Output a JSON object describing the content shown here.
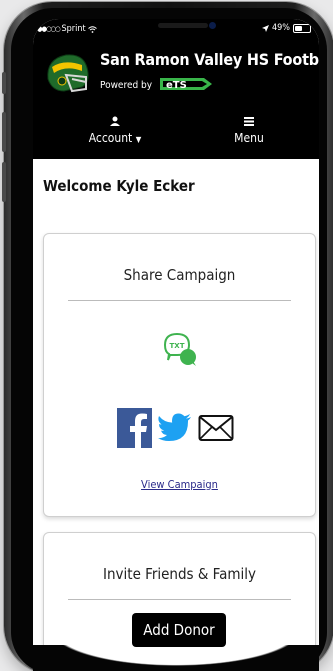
{
  "status": {
    "carrier": "Sprint",
    "signal_dots": "●●○○○",
    "battery_pct": "49%",
    "battery_level": 0.49
  },
  "header": {
    "team_name": "San Ramon Valley HS Football",
    "powered_by": "Powered by",
    "ets_text": "eTS"
  },
  "nav": {
    "account_label": "Account",
    "menu_label": "Menu"
  },
  "main": {
    "welcome": "Welcome Kyle Ecker",
    "share_card": {
      "title": "Share Campaign",
      "txt_label": "TXT",
      "view_link": "View Campaign"
    },
    "invite_card": {
      "title": "Invite Friends & Family",
      "button_label": "Add Donor"
    }
  },
  "colors": {
    "facebook": "#3b5998",
    "twitter": "#1da1f2",
    "txt_green": "#3fb34f",
    "ets_green": "#39b54a",
    "helmet_green": "#1f6b2a",
    "helmet_gold": "#f2c400"
  }
}
